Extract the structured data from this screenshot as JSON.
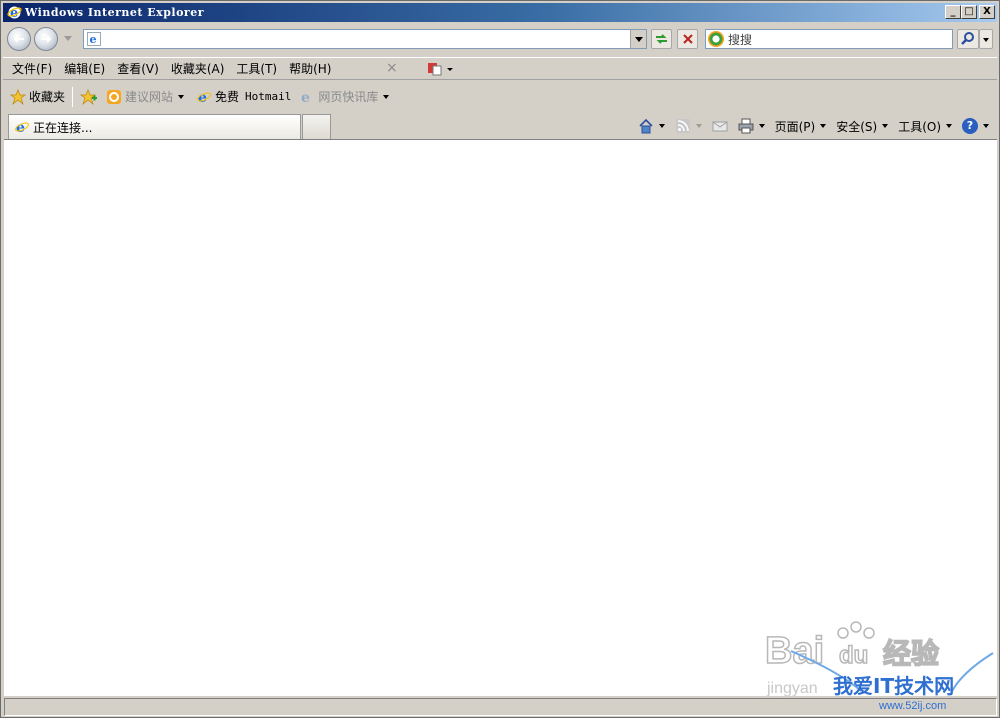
{
  "window": {
    "title": "Windows Internet Explorer",
    "buttons": [
      "_",
      "□",
      "X"
    ]
  },
  "address": {
    "value": "",
    "placeholder": ""
  },
  "search": {
    "value": "搜搜",
    "provider_icon": "soso-logo-icon"
  },
  "menu": {
    "items": [
      "文件(F)",
      "编辑(E)",
      "查看(V)",
      "收藏夹(A)",
      "工具(T)",
      "帮助(H)"
    ],
    "close_glyph": "×"
  },
  "favorites": {
    "label": "收藏夹",
    "suggested_sites": "建议网站",
    "hotmail_prefix": "免费",
    "hotmail_name": "Hotmail",
    "web_slice": "网页快讯库"
  },
  "tabs": [
    {
      "label": "正在连接..."
    }
  ],
  "commandbar": {
    "page": "页面(P)",
    "safety": "安全(S)",
    "tools": "工具(O)",
    "help_glyph": "?"
  },
  "watermark": {
    "baidu": "Bai",
    "du": "du",
    "jingyan": "经验",
    "site_name": "我爱IT技术网",
    "site_url": "www.52ij.com",
    "jingyan_url": "jingyan"
  },
  "colors": {
    "titlebar_start": "#0a246a",
    "titlebar_end": "#a6caf0",
    "chrome": "#d4d0c8",
    "content": "#ffffff"
  }
}
